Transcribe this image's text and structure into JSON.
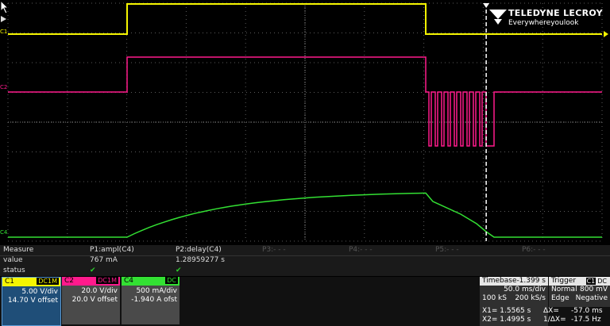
{
  "brand": {
    "name": "TELEDYNE LECROY",
    "tagline": "Everywhereyoulook"
  },
  "channel_markers": {
    "c1": "C1",
    "c2": "C2",
    "c4": "C4"
  },
  "colors": {
    "c1": "#f5f500",
    "c2": "#ff1a8c",
    "c4": "#33e033",
    "grid": "#5a5a5a"
  },
  "waveforms": {
    "c1_levels": {
      "low": 43,
      "high": 5
    },
    "trigger_time_fraction": 0.805
  },
  "measure": {
    "headers": [
      "Measure",
      "P1:ampl(C4)",
      "P2:delay(C4)",
      "P3:- - -",
      "P4:- - -",
      "P5:- - -",
      "P6:- - -"
    ],
    "value_label": "value",
    "values": [
      "767 mA",
      "1.28959277 s"
    ],
    "status_label": "status",
    "status_marks": [
      "✔",
      "✔"
    ]
  },
  "channels": [
    {
      "name": "C1",
      "coupling": "DC1M",
      "vdiv": "5.00 V/div",
      "offset": "14.70 V offset"
    },
    {
      "name": "C2",
      "coupling": "DC1M",
      "vdiv": "20.0 V/div",
      "offset": "20.0 V offset"
    },
    {
      "name": "C4",
      "coupling": "DC",
      "vdiv": "500 mA/div",
      "offset": "-1.940 A ofst"
    }
  ],
  "timebase": {
    "label": "Timebase",
    "delay": "-1.399 s",
    "tdiv": "50.0 ms/div",
    "samples": "100 kS",
    "rate": "200 kS/s"
  },
  "trigger": {
    "label": "Trigger",
    "source": "C1",
    "coupling": "DC",
    "mode": "Normal",
    "level": "800 mV",
    "type": "Edge",
    "slope": "Negative"
  },
  "cursors": {
    "x1": "X1= 1.5565 s",
    "dx": "ΔX=",
    "dx_value": "-57.0 ms",
    "x2": "X2= 1.4995 s",
    "inv_dx": "1/ΔX=",
    "inv_dx_value": "-17.5 Hz"
  }
}
